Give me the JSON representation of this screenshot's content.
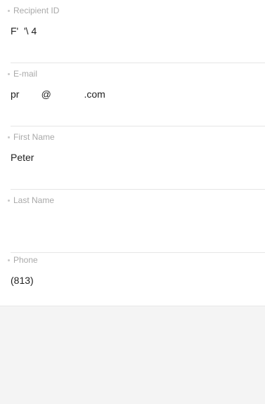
{
  "form": {
    "fields": [
      {
        "label": "Recipient ID",
        "value": "F'  '\\ 4"
      },
      {
        "label": "E-mail",
        "value": "pr        @            .com"
      },
      {
        "label": "First Name",
        "value": "Peter"
      },
      {
        "label": "Last Name",
        "value": ""
      },
      {
        "label": "Phone",
        "value": "(813)"
      }
    ]
  }
}
